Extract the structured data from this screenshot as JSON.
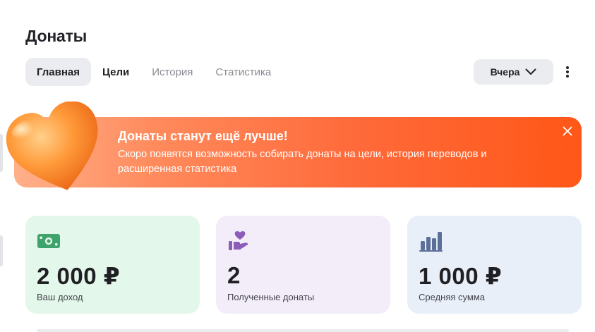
{
  "page": {
    "title": "Донаты"
  },
  "tabs": [
    {
      "label": "Главная",
      "state": "active"
    },
    {
      "label": "Цели",
      "state": "strong"
    },
    {
      "label": "История",
      "state": "muted"
    },
    {
      "label": "Статистика",
      "state": "muted"
    }
  ],
  "period": {
    "label": "Вчера",
    "icon": "chevron-down-icon"
  },
  "more": {
    "icon": "vertical-dots-icon"
  },
  "banner": {
    "title": "Донаты станут ещё лучше!",
    "text": "Скоро появятся возможность собирать донаты на цели, история переводов и расширенная статистика",
    "close_icon": "close-icon",
    "illustration": "heart-icon",
    "colors": {
      "from": "#ffb08a",
      "to": "#ff5718"
    }
  },
  "stats": {
    "income": {
      "value": "2 000 ₽",
      "label": "Ваш доход",
      "icon": "money-icon",
      "icon_color": "#3fa36c",
      "bg": "#e3f7ea"
    },
    "donations": {
      "value": "2",
      "label": "Полученные донаты",
      "icon": "hand-heart-icon",
      "icon_color": "#8b5cb8",
      "bg": "#f3edf9"
    },
    "average": {
      "value": "1 000 ₽",
      "label": "Средняя сумма",
      "icon": "bar-chart-icon",
      "icon_color": "#5b6f99",
      "bg": "#e8eff9"
    }
  }
}
